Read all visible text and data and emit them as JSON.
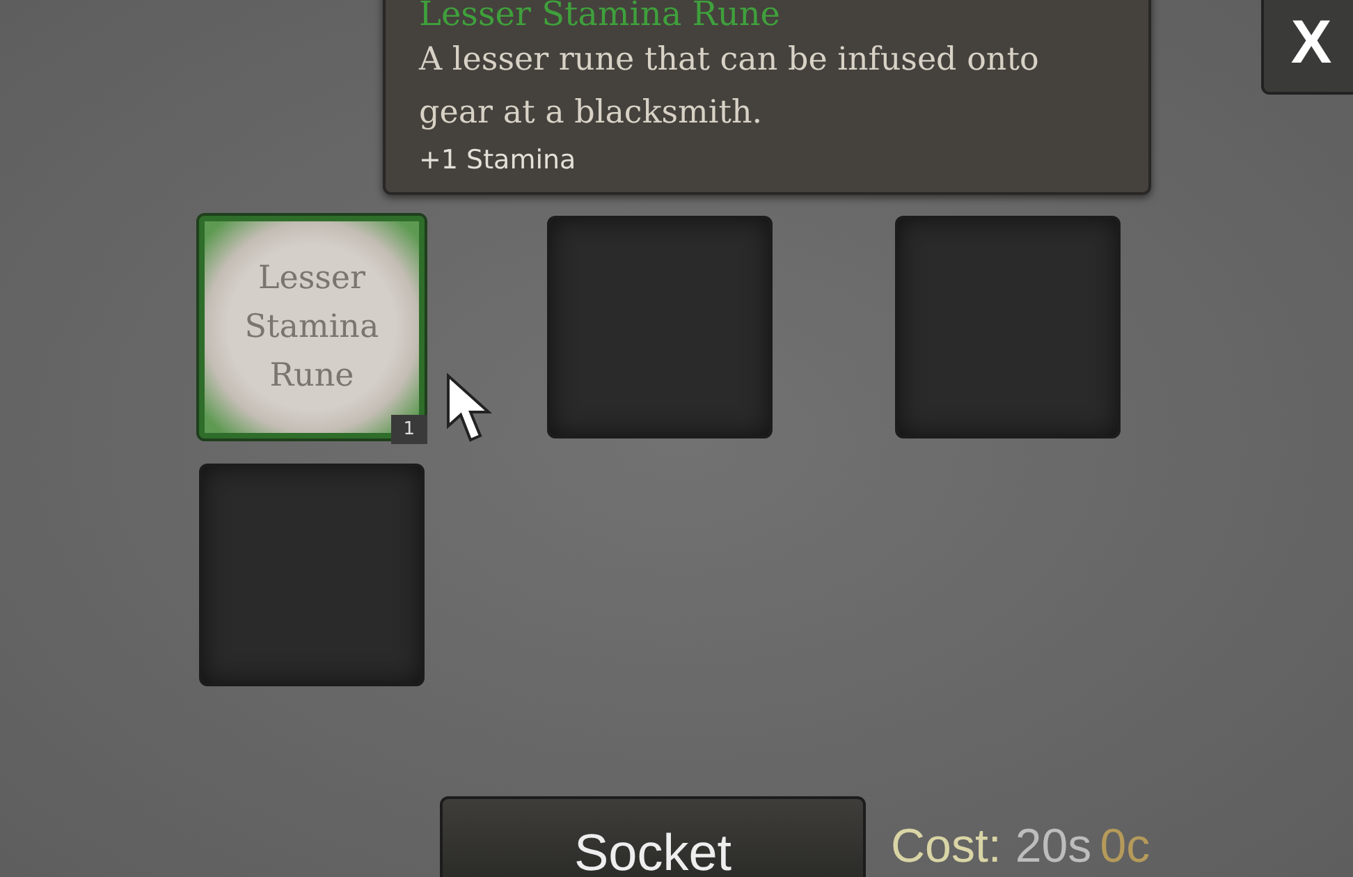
{
  "tooltip": {
    "title": "Lesser Stamina Rune",
    "description": "A lesser rune that can be infused onto gear at a blacksmith.",
    "stat": "+1 Stamina"
  },
  "close_button": {
    "label": "X"
  },
  "slots": [
    {
      "kind": "rune",
      "label": "Lesser Stamina Rune",
      "count": "1"
    },
    {
      "kind": "empty"
    },
    {
      "kind": "empty"
    },
    {
      "kind": "empty"
    }
  ],
  "socket_button": {
    "label": "Socket"
  },
  "cost": {
    "label": "Cost:",
    "silver": "20s",
    "copper": "0c"
  }
}
